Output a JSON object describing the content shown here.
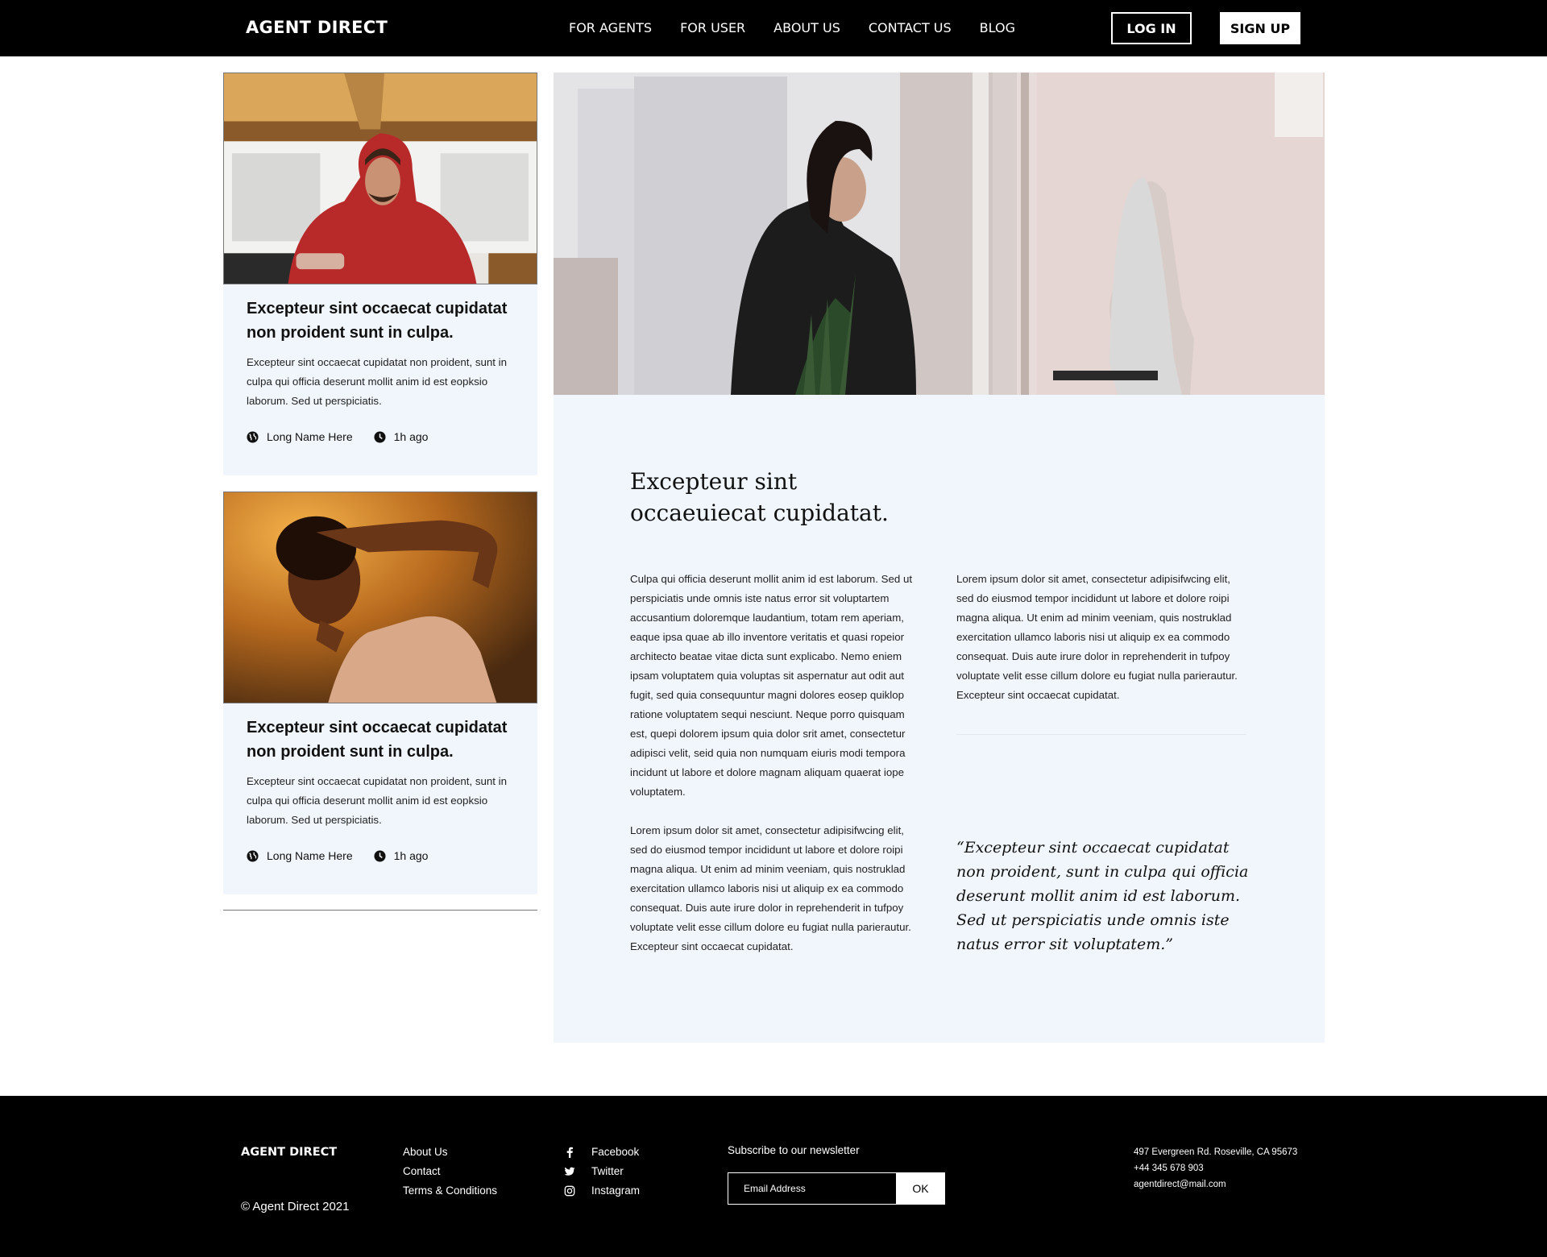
{
  "header": {
    "logo": "AGENT DIRECT",
    "nav": [
      "FOR AGENTS",
      "FOR USER",
      "ABOUT US",
      "CONTACT US",
      "BLOG"
    ],
    "login_label": "LOG IN",
    "signup_label": "SIGN UP"
  },
  "cards": [
    {
      "title": "Excepteur sint occaecat cupidatat non proident sunt in culpa.",
      "text": "Excepteur sint occaecat cupidatat non proident, sunt in culpa qui officia deserunt mollit anim id est eopksio laborum. Sed ut perspiciatis.",
      "author": "Long Name Here",
      "time": "1h ago",
      "author_icon": "globe-icon",
      "time_icon": "clock-icon"
    },
    {
      "title": "Excepteur sint occaecat cupidatat non proident sunt in culpa.",
      "text": "Excepteur sint occaecat cupidatat non proident, sunt in culpa qui officia deserunt mollit anim id est eopksio laborum. Sed ut perspiciatis.",
      "author": "Long Name Here",
      "time": "1h ago",
      "author_icon": "globe-icon",
      "time_icon": "clock-icon"
    }
  ],
  "article": {
    "title": "Excepteur sint occaeuiecat cupidatat.",
    "col1_p1": "Culpa qui officia deserunt mollit anim id est laborum. Sed ut perspiciatis unde omnis iste natus error sit voluptartem accusantium doloremque laudantium, totam rem aperiam, eaque ipsa quae ab illo inventore veritatis et quasi ropeior architecto beatae vitae dicta sunt explicabo. Nemo eniem ipsam voluptatem quia voluptas sit aspernatur aut odit aut fugit, sed quia consequuntur magni dolores eosep quiklop ratione voluptatem sequi nesciunt. Neque porro quisquam est, quepi dolorem ipsum quia dolor srit amet, consectetur adipisci velit, seid quia non numquam eiuris modi tempora incidunt ut labore et dolore magnam aliquam quaerat iope voluptatem.",
    "col1_p2": "Lorem ipsum dolor sit amet, consectetur adipisifwcing elit, sed do eiusmod tempor incididunt ut labore et dolore roipi magna aliqua. Ut enim ad minim veeniam, quis nostruklad exercitation ullamco laboris nisi ut aliquip ex ea commodo consequat. Duis aute irure dolor in reprehenderit in tufpoy voluptate velit esse cillum dolore eu fugiat nulla parierautur. Excepteur sint occaecat cupidatat.",
    "col2_p1": "Lorem ipsum dolor sit amet, consectetur adipisifwcing elit, sed do eiusmod tempor incididunt ut labore et dolore roipi magna aliqua. Ut enim ad minim veeniam, quis nostruklad exercitation ullamco laboris nisi ut aliquip ex ea commodo consequat. Duis aute irure dolor in reprehenderit in tufpoy voluptate velit esse cillum dolore eu fugiat nulla parierautur. Excepteur sint occaecat cupidatat.",
    "quote": "“Excepteur sint occaecat cupidatat non proident, sunt in culpa qui officia deserunt mollit anim id est laborum. Sed ut perspiciatis unde omnis iste natus error sit voluptatem.”"
  },
  "footer": {
    "logo": "AGENT DIRECT",
    "copyright": "© Agent Direct 2021",
    "links": [
      "About Us",
      "Contact",
      "Terms & Conditions"
    ],
    "social": [
      {
        "label": "Facebook",
        "icon": "facebook-icon"
      },
      {
        "label": "Twitter",
        "icon": "twitter-icon"
      },
      {
        "label": "Instagram",
        "icon": "instagram-icon"
      }
    ],
    "newsletter_label": "Subscribe to our newsletter",
    "email_placeholder": "Email Address",
    "ok_label": "OK",
    "address": "497 Evergreen Rd. Roseville, CA 95673",
    "phone": "+44 345 678 903",
    "email": "agentdirect@mail.com"
  }
}
